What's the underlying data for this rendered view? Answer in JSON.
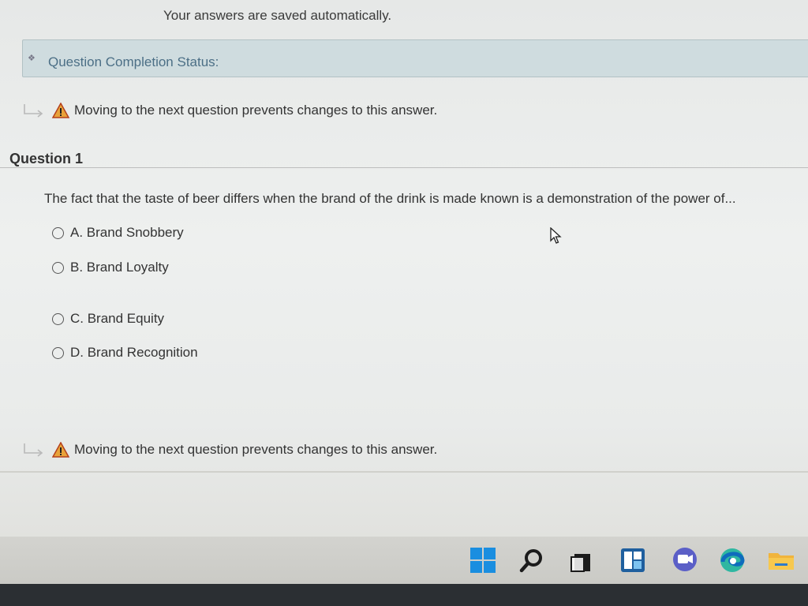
{
  "header": {
    "autosave_text": "Your answers are saved automatically."
  },
  "status_bar": {
    "label": "Question Completion Status:",
    "toggle_icon": "collapse-toggle-icon"
  },
  "warnings": {
    "top": "Moving to the next question prevents changes to this answer.",
    "bottom": "Moving to the next question prevents changes to this answer."
  },
  "question": {
    "title": "Question 1",
    "text": "The fact that the taste of beer differs when the brand of the drink is made known is a demonstration of the power of...",
    "options": [
      {
        "label": "A. Brand Snobbery",
        "selected": false
      },
      {
        "label": "B. Brand Loyalty",
        "selected": false
      },
      {
        "label": "C. Brand Equity",
        "selected": false
      },
      {
        "label": "D. Brand Recognition",
        "selected": false
      }
    ]
  },
  "taskbar": {
    "icons": [
      "windows-start-icon",
      "search-icon",
      "task-view-icon",
      "widgets-icon",
      "chat-icon",
      "edge-browser-icon",
      "file-explorer-icon"
    ]
  },
  "colors": {
    "status_bar_bg": "#cfdcdf",
    "status_label": "#4c6f86",
    "warning_triangle": "#e8a33a",
    "windows_blue": "#1a8ee0"
  }
}
